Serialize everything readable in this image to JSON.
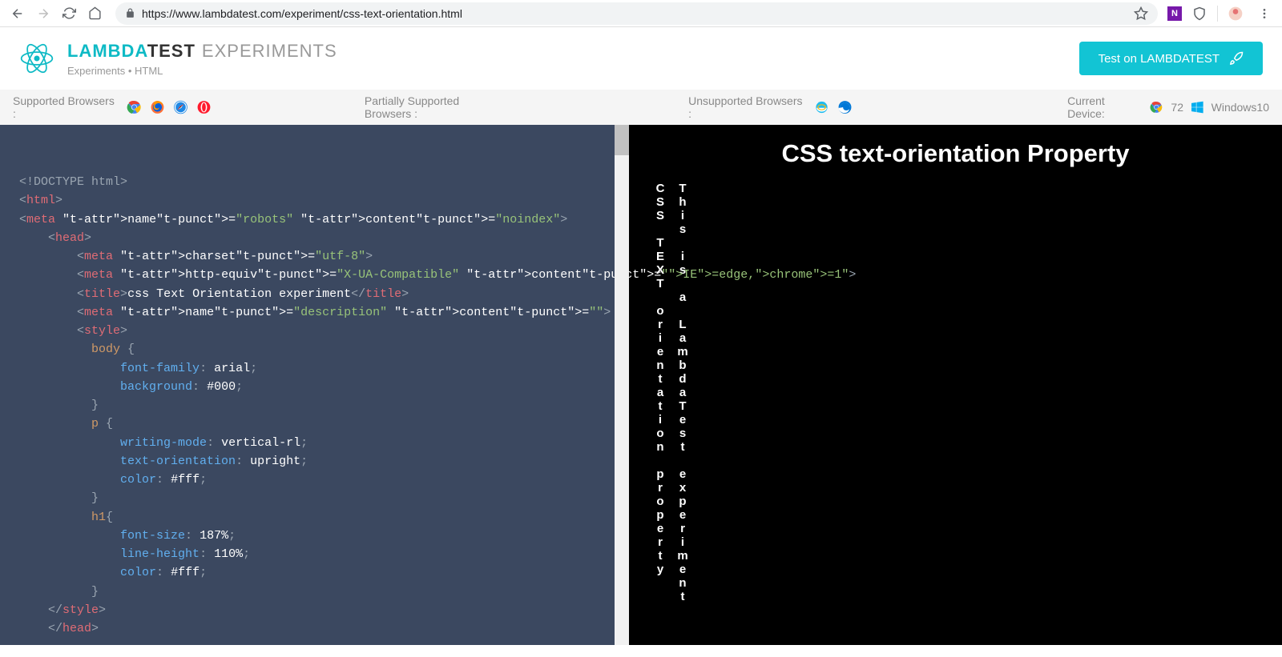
{
  "browser": {
    "url": "https://www.lambdatest.com/experiment/css-text-orientation.html"
  },
  "header": {
    "brand_lambda": "LAMBDA",
    "brand_test": "TEST",
    "brand_experiments": "EXPERIMENTS",
    "breadcrumb": "Experiments • HTML",
    "cta": "Test on LAMBDATEST"
  },
  "strip": {
    "supported": "Supported Browsers :",
    "partial": "Partially Supported Browsers :",
    "unsupported": "Unsupported Browsers :",
    "device": "Current Device:",
    "device_ver": "72",
    "device_os": "Windows10"
  },
  "code": [
    "<!DOCTYPE html>",
    "<html>",
    "<meta name=\"robots\" content=\"noindex\">",
    "    <head>",
    "        <meta charset=\"utf-8\">",
    "        <meta http-equiv=\"X-UA-Compatible\" content=\"IE=edge,chrome=1\">",
    "        <title>css Text Orientation experiment</title>",
    "        <meta name=\"description\" content=\"\">",
    "        <style>",
    "          body {",
    "              font-family: arial;",
    "              background: #000;",
    "          }",
    "          p {",
    "              writing-mode: vertical-rl;",
    "              text-orientation: upright;",
    "              color: #fff;",
    "          }",
    "          h1{",
    "              font-size: 187%;",
    "              line-height: 110%;",
    "              color: #fff;",
    "          }",
    "    </style>",
    "    </head>"
  ],
  "preview": {
    "title": "CSS text-orientation Property",
    "col1": "CSS TEXT orientation property",
    "col2": "This is a LambdaTest experiment"
  }
}
